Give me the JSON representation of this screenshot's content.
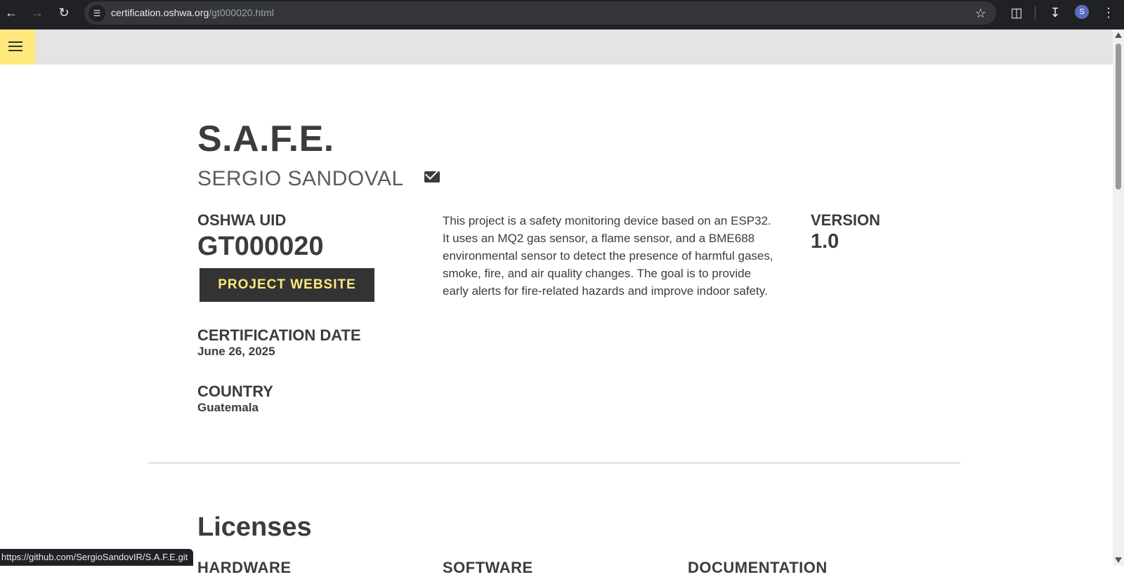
{
  "browser": {
    "url_domain": "certification.oshwa.org",
    "url_path": "/gt000020.html",
    "profile_initial": "S",
    "status_url": "https://github.com/SergioSandovIR/S.A.F.E.git"
  },
  "project": {
    "title": "S.A.F.E.",
    "author": "SERGIO SANDOVAL",
    "uid_label": "OSHWA UID",
    "uid": "GT000020",
    "website_button": "PROJECT WEBSITE",
    "cert_date_label": "CERTIFICATION DATE",
    "cert_date": "June 26, 2025",
    "country_label": "COUNTRY",
    "country": "Guatemala",
    "description": "This project is a safety monitoring device based on an ESP32. It uses an MQ2 gas sensor, a flame sensor, and a BME688 environmental sensor to detect the presence of harmful gases, smoke, fire, and air quality changes. The goal is to provide early alerts for fire-related hazards and improve indoor safety.",
    "version_label": "VERSION",
    "version": "1.0"
  },
  "licenses": {
    "heading": "Licenses",
    "hardware_label": "HARDWARE",
    "software_label": "SOFTWARE",
    "documentation_label": "DOCUMENTATION"
  }
}
